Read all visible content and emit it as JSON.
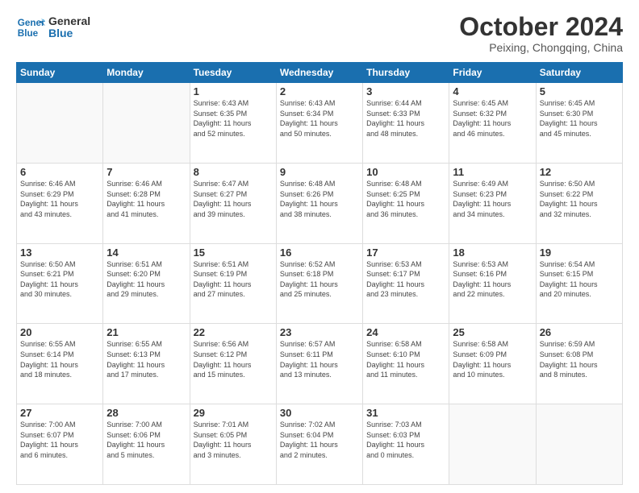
{
  "logo": {
    "line1": "General",
    "line2": "Blue"
  },
  "title": "October 2024",
  "subtitle": "Peixing, Chongqing, China",
  "weekdays": [
    "Sunday",
    "Monday",
    "Tuesday",
    "Wednesday",
    "Thursday",
    "Friday",
    "Saturday"
  ],
  "days": [
    {
      "num": "",
      "info": ""
    },
    {
      "num": "",
      "info": ""
    },
    {
      "num": "1",
      "info": "Sunrise: 6:43 AM\nSunset: 6:35 PM\nDaylight: 11 hours\nand 52 minutes."
    },
    {
      "num": "2",
      "info": "Sunrise: 6:43 AM\nSunset: 6:34 PM\nDaylight: 11 hours\nand 50 minutes."
    },
    {
      "num": "3",
      "info": "Sunrise: 6:44 AM\nSunset: 6:33 PM\nDaylight: 11 hours\nand 48 minutes."
    },
    {
      "num": "4",
      "info": "Sunrise: 6:45 AM\nSunset: 6:32 PM\nDaylight: 11 hours\nand 46 minutes."
    },
    {
      "num": "5",
      "info": "Sunrise: 6:45 AM\nSunset: 6:30 PM\nDaylight: 11 hours\nand 45 minutes."
    },
    {
      "num": "6",
      "info": "Sunrise: 6:46 AM\nSunset: 6:29 PM\nDaylight: 11 hours\nand 43 minutes."
    },
    {
      "num": "7",
      "info": "Sunrise: 6:46 AM\nSunset: 6:28 PM\nDaylight: 11 hours\nand 41 minutes."
    },
    {
      "num": "8",
      "info": "Sunrise: 6:47 AM\nSunset: 6:27 PM\nDaylight: 11 hours\nand 39 minutes."
    },
    {
      "num": "9",
      "info": "Sunrise: 6:48 AM\nSunset: 6:26 PM\nDaylight: 11 hours\nand 38 minutes."
    },
    {
      "num": "10",
      "info": "Sunrise: 6:48 AM\nSunset: 6:25 PM\nDaylight: 11 hours\nand 36 minutes."
    },
    {
      "num": "11",
      "info": "Sunrise: 6:49 AM\nSunset: 6:23 PM\nDaylight: 11 hours\nand 34 minutes."
    },
    {
      "num": "12",
      "info": "Sunrise: 6:50 AM\nSunset: 6:22 PM\nDaylight: 11 hours\nand 32 minutes."
    },
    {
      "num": "13",
      "info": "Sunrise: 6:50 AM\nSunset: 6:21 PM\nDaylight: 11 hours\nand 30 minutes."
    },
    {
      "num": "14",
      "info": "Sunrise: 6:51 AM\nSunset: 6:20 PM\nDaylight: 11 hours\nand 29 minutes."
    },
    {
      "num": "15",
      "info": "Sunrise: 6:51 AM\nSunset: 6:19 PM\nDaylight: 11 hours\nand 27 minutes."
    },
    {
      "num": "16",
      "info": "Sunrise: 6:52 AM\nSunset: 6:18 PM\nDaylight: 11 hours\nand 25 minutes."
    },
    {
      "num": "17",
      "info": "Sunrise: 6:53 AM\nSunset: 6:17 PM\nDaylight: 11 hours\nand 23 minutes."
    },
    {
      "num": "18",
      "info": "Sunrise: 6:53 AM\nSunset: 6:16 PM\nDaylight: 11 hours\nand 22 minutes."
    },
    {
      "num": "19",
      "info": "Sunrise: 6:54 AM\nSunset: 6:15 PM\nDaylight: 11 hours\nand 20 minutes."
    },
    {
      "num": "20",
      "info": "Sunrise: 6:55 AM\nSunset: 6:14 PM\nDaylight: 11 hours\nand 18 minutes."
    },
    {
      "num": "21",
      "info": "Sunrise: 6:55 AM\nSunset: 6:13 PM\nDaylight: 11 hours\nand 17 minutes."
    },
    {
      "num": "22",
      "info": "Sunrise: 6:56 AM\nSunset: 6:12 PM\nDaylight: 11 hours\nand 15 minutes."
    },
    {
      "num": "23",
      "info": "Sunrise: 6:57 AM\nSunset: 6:11 PM\nDaylight: 11 hours\nand 13 minutes."
    },
    {
      "num": "24",
      "info": "Sunrise: 6:58 AM\nSunset: 6:10 PM\nDaylight: 11 hours\nand 11 minutes."
    },
    {
      "num": "25",
      "info": "Sunrise: 6:58 AM\nSunset: 6:09 PM\nDaylight: 11 hours\nand 10 minutes."
    },
    {
      "num": "26",
      "info": "Sunrise: 6:59 AM\nSunset: 6:08 PM\nDaylight: 11 hours\nand 8 minutes."
    },
    {
      "num": "27",
      "info": "Sunrise: 7:00 AM\nSunset: 6:07 PM\nDaylight: 11 hours\nand 6 minutes."
    },
    {
      "num": "28",
      "info": "Sunrise: 7:00 AM\nSunset: 6:06 PM\nDaylight: 11 hours\nand 5 minutes."
    },
    {
      "num": "29",
      "info": "Sunrise: 7:01 AM\nSunset: 6:05 PM\nDaylight: 11 hours\nand 3 minutes."
    },
    {
      "num": "30",
      "info": "Sunrise: 7:02 AM\nSunset: 6:04 PM\nDaylight: 11 hours\nand 2 minutes."
    },
    {
      "num": "31",
      "info": "Sunrise: 7:03 AM\nSunset: 6:03 PM\nDaylight: 11 hours\nand 0 minutes."
    },
    {
      "num": "",
      "info": ""
    },
    {
      "num": "",
      "info": ""
    },
    {
      "num": "",
      "info": ""
    }
  ]
}
